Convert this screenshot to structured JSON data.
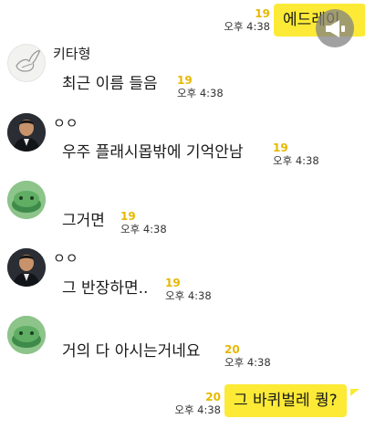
{
  "messages": [
    {
      "type": "out",
      "text": "에드레이",
      "count": "19",
      "time": "오후 4:38"
    },
    {
      "type": "in",
      "sender": "키타형",
      "avatar": "dove",
      "text": "최근 이름 들음",
      "count": "19",
      "time": "오후 4:38"
    },
    {
      "type": "in",
      "sender": "ㅇㅇ",
      "avatar": "man",
      "text": "우주 플래시몹밖에 기억안남",
      "count": "19",
      "time": "오후 4:38"
    },
    {
      "type": "in",
      "sender": "",
      "avatar": "green",
      "text": "그거면",
      "count": "19",
      "time": "오후 4:38"
    },
    {
      "type": "in",
      "sender": "ㅇㅇ",
      "avatar": "man",
      "text": "그 반장하면..",
      "count": "19",
      "time": "오후 4:38"
    },
    {
      "type": "in",
      "sender": "",
      "avatar": "green",
      "text": "거의 다 아시는거네요",
      "count": "20",
      "time": "오후 4:38"
    },
    {
      "type": "out",
      "text": "그 바퀴벌레 퀑?",
      "count": "20",
      "time": "오후 4:38"
    }
  ],
  "colors": {
    "out_bubble": "#fcea36",
    "in_bubble": "#ffffff",
    "unread": "#e6b800"
  }
}
